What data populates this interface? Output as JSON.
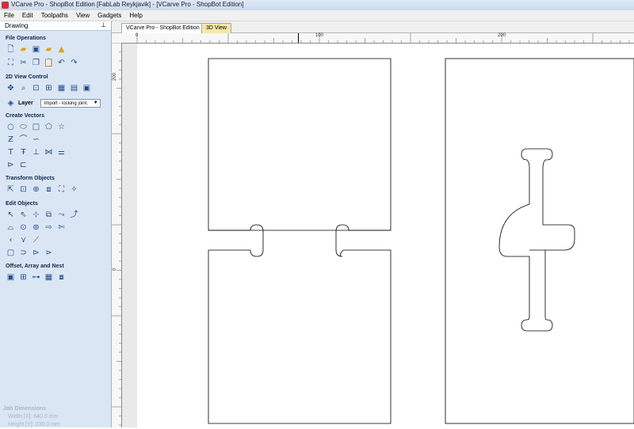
{
  "window": {
    "title": "VCarve Pro - ShopBot Edition [FabLab Reykjavik] - [VCarve Pro - ShopBot Edition]"
  },
  "menu": [
    "File",
    "Edit",
    "Toolpaths",
    "View",
    "Gadgets",
    "Help"
  ],
  "panel": {
    "header": "Drawing",
    "pin_glyph": "⊥",
    "sections": {
      "file_operations": "File Operations",
      "view_control": "2D View Control",
      "create_vectors": "Create Vectors",
      "transform": "Transform Objects",
      "edit": "Edit Objects",
      "offset": "Offset, Array and Nest"
    },
    "layer": {
      "label": "Layer",
      "value": "Import - locking joint."
    },
    "job_dimensions": {
      "title": "Job Dimensions",
      "width": "Width  [X]: 640.0 mm",
      "height": "Height [Y]: 230.0 mm"
    }
  },
  "tabs": {
    "main": "VCarve Pro - ShopBot Edition",
    "view3d": "3D View"
  },
  "rulers": {
    "top": [
      "0",
      "100",
      "200"
    ],
    "left": [
      "200",
      "0"
    ]
  },
  "icons": {
    "file": [
      "new-file-icon",
      "open-file-icon",
      "save-icon",
      "folder-icon",
      "import-icon",
      "select-icon",
      "cut-icon",
      "copy-icon",
      "paste-icon",
      "undo-icon",
      "redo-icon"
    ],
    "view": [
      "pan-icon",
      "zoom-icon",
      "zoom-box-icon",
      "zoom-fit-icon",
      "grid-icon",
      "ruler-icon",
      "window-icon"
    ],
    "create": [
      "circle-icon",
      "ellipse-icon",
      "rectangle-icon",
      "polygon-icon",
      "star-icon",
      "polyline-icon",
      "arc-icon",
      "curve-icon",
      "text-icon",
      "text-on-curve-icon",
      "dimension-icon",
      "measure-icon",
      "hatch-icon",
      "bezier-icon"
    ],
    "transform": [
      "move-icon",
      "align-icon",
      "center-icon",
      "mirror-icon",
      "scale-icon",
      "rotate-icon"
    ],
    "edit": [
      "pointer-icon",
      "node-edit-icon",
      "smart-snap-icon",
      "trim-icon",
      "fillet-icon",
      "join-icon",
      "close-icon",
      "extend-icon",
      "weld-icon",
      "subtract-icon",
      "intersect-icon",
      "interactive-trim-icon",
      "reverse-icon",
      "corner-icon",
      "fillet-tool-icon",
      "bounding-icon",
      "offset-icon",
      "arc-fit-icon"
    ],
    "offset": [
      "offset-vector-icon",
      "array-icon",
      "circular-array-icon",
      "nest-icon",
      "copy-along-icon"
    ]
  }
}
